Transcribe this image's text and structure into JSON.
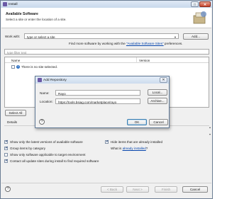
{
  "window": {
    "title": "Install",
    "close_glyph": "✕",
    "max_glyph": "□"
  },
  "header": {
    "title": "Available Software",
    "subtitle": "Select a site or enter the location of a site."
  },
  "work_with": {
    "label": "Work with:",
    "placeholder": "type or select a site",
    "add_button": "Add...",
    "find_more_prefix": "Find more software by working with the ",
    "find_more_link": "\"Available Software Sites\"",
    "find_more_suffix": " preferences."
  },
  "filter": {
    "placeholder": "type filter text"
  },
  "table": {
    "columns": [
      "Name",
      "Version"
    ],
    "rows": [
      {
        "label": "There is no site selected."
      }
    ]
  },
  "select_all_button": "Select All",
  "details": {
    "label": "Details"
  },
  "options": {
    "show_latest": "Show only the latest versions of available software",
    "group_by_category": "Group items by category",
    "show_applicable": "Show only software applicable to target environment",
    "contact_update_sites": "Contact all update sites during install to find required software",
    "hide_installed": "Hide items that are already installed",
    "what_is_prefix": "What is ",
    "what_is_link": "already installed",
    "what_is_suffix": "?"
  },
  "footer": {
    "back": "< Back",
    "next": "Next >",
    "finish": "Finish",
    "cancel": "Cancel"
  },
  "dialog": {
    "title": "Add Repository",
    "close_glyph": "✕",
    "name_label": "Name:",
    "name_value": "Rayo",
    "location_label": "Location:",
    "location_value": "https://tools.bsiag.com/marketplace/rayo",
    "local_button": "Local...",
    "archive_button": "Archive...",
    "ok_button": "OK",
    "cancel_button": "Cancel",
    "help_glyph": "?"
  },
  "colors": {
    "accent": "#3c7fb1",
    "link": "#0645ad",
    "info": "#2f72c4"
  }
}
